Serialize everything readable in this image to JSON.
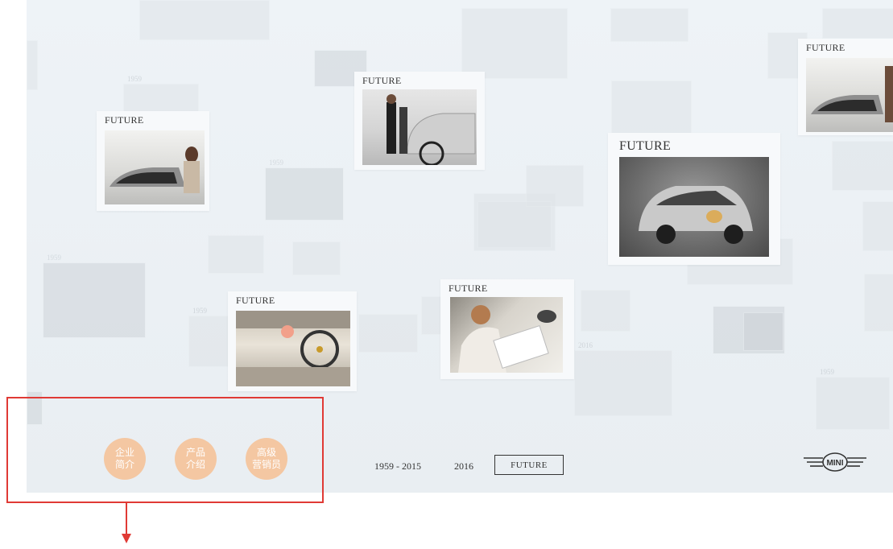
{
  "gallery": {
    "future_label": "FUTURE",
    "year_labels": [
      "1959",
      "1959",
      "1959",
      "1959",
      "1959",
      "2016"
    ]
  },
  "nav": {
    "buttons": [
      {
        "label": "企业\n简介"
      },
      {
        "label": "产品\n介绍"
      },
      {
        "label": "高级\n营销员"
      }
    ]
  },
  "timeline": {
    "items": [
      "1959 - 2015",
      "2016"
    ],
    "selected": "FUTURE"
  },
  "brand": {
    "logo_text": "MINI"
  },
  "colors": {
    "button_fill": "#f4c7a2",
    "annotation_red": "#e03a35",
    "background": "#eef3f7"
  }
}
